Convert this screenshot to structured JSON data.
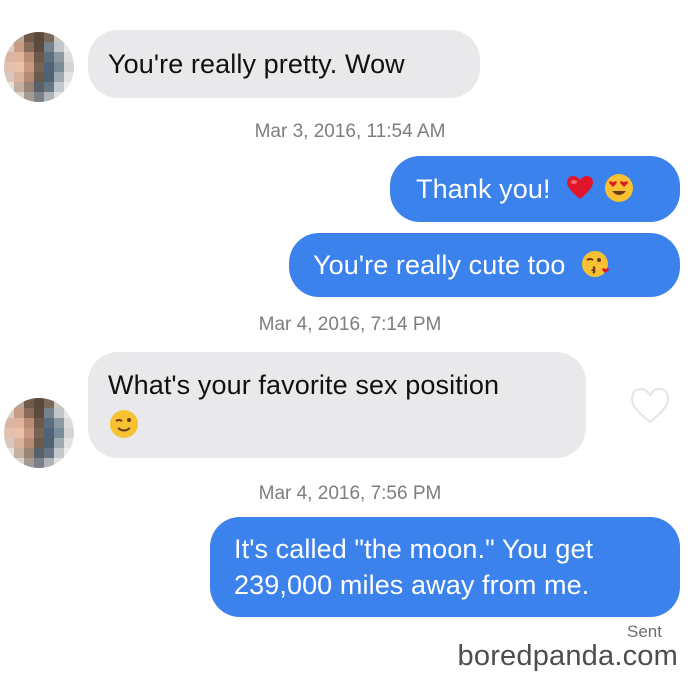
{
  "messages": [
    {
      "text": "You're really pretty. Wow"
    },
    {
      "text": "Thank you!"
    },
    {
      "text": "You're really cute too"
    },
    {
      "text": "What's your favorite sex position"
    },
    {
      "line1": "It's called \"the moon.\" You get",
      "line2": "239,000 miles away from me."
    }
  ],
  "timestamps": [
    "Mar 3, 2016, 11:54 AM",
    "Mar 4, 2016, 7:14 PM",
    "Mar 4, 2016, 7:56 PM"
  ],
  "status": {
    "sent": "Sent"
  },
  "watermark": "boredpanda.com",
  "colors": {
    "outgoing_bubble": "#3b82ec",
    "incoming_bubble": "#e9e9eb",
    "timestamp": "#7d7d82"
  },
  "icons": [
    "heart-emoji",
    "heart-eyes-emoji",
    "kissing-wink-emoji",
    "winking-face-emoji",
    "like-heart-icon",
    "avatar"
  ]
}
